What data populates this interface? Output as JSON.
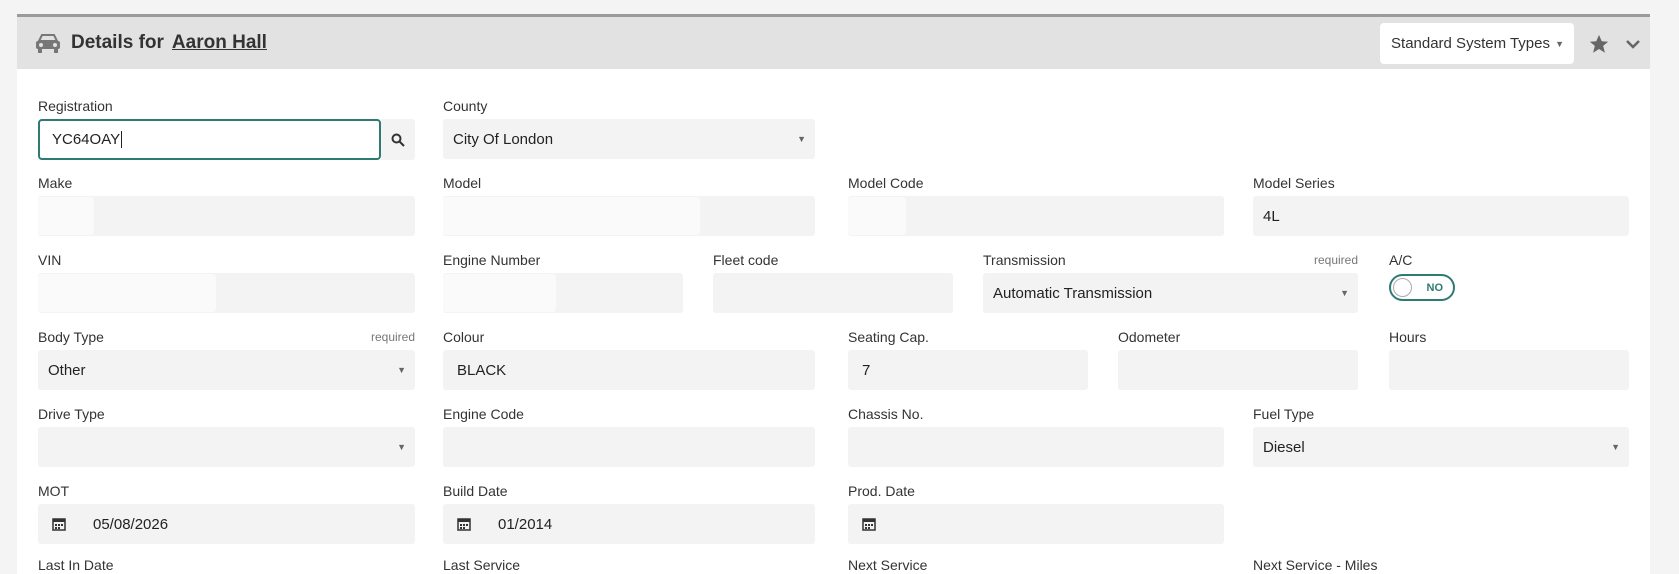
{
  "header": {
    "title_prefix": "Details for",
    "title_name": "Aaron Hall",
    "system_select": "Standard System Types"
  },
  "registration": {
    "label": "Registration",
    "value": "YC64OAY"
  },
  "county": {
    "label": "County",
    "value": "City Of London"
  },
  "make": {
    "label": "Make",
    "value": ""
  },
  "model": {
    "label": "Model",
    "value": ""
  },
  "model_code": {
    "label": "Model Code",
    "value": ""
  },
  "model_series": {
    "label": "Model Series",
    "value": "4L"
  },
  "vin": {
    "label": "VIN",
    "value": ""
  },
  "engine_number": {
    "label": "Engine Number",
    "value": ""
  },
  "fleet_code": {
    "label": "Fleet code",
    "value": ""
  },
  "transmission": {
    "label": "Transmission",
    "required": "required",
    "value": "Automatic Transmission"
  },
  "ac": {
    "label": "A/C",
    "value": "NO"
  },
  "body_type": {
    "label": "Body Type",
    "required": "required",
    "value": "Other"
  },
  "colour": {
    "label": "Colour",
    "value": "BLACK"
  },
  "seating": {
    "label": "Seating Cap.",
    "value": "7"
  },
  "odometer": {
    "label": "Odometer",
    "value": ""
  },
  "hours": {
    "label": "Hours",
    "value": ""
  },
  "drive_type": {
    "label": "Drive Type",
    "value": ""
  },
  "engine_code": {
    "label": "Engine Code",
    "value": ""
  },
  "chassis": {
    "label": "Chassis No.",
    "value": ""
  },
  "fuel_type": {
    "label": "Fuel Type",
    "value": "Diesel"
  },
  "mot": {
    "label": "MOT",
    "value": "05/08/2026"
  },
  "build_date": {
    "label": "Build Date",
    "value": "01/2014"
  },
  "prod_date": {
    "label": "Prod. Date",
    "value": ""
  },
  "partial_labels": {
    "last_in": "Last In Date",
    "last_service": "Last Service",
    "next_service": "Next Service",
    "next_service_miles": "Next Service - Miles"
  },
  "colors": {
    "accent": "#2f7a72",
    "header_bg": "#e2e2e2",
    "field_bg": "#f3f3f3"
  }
}
